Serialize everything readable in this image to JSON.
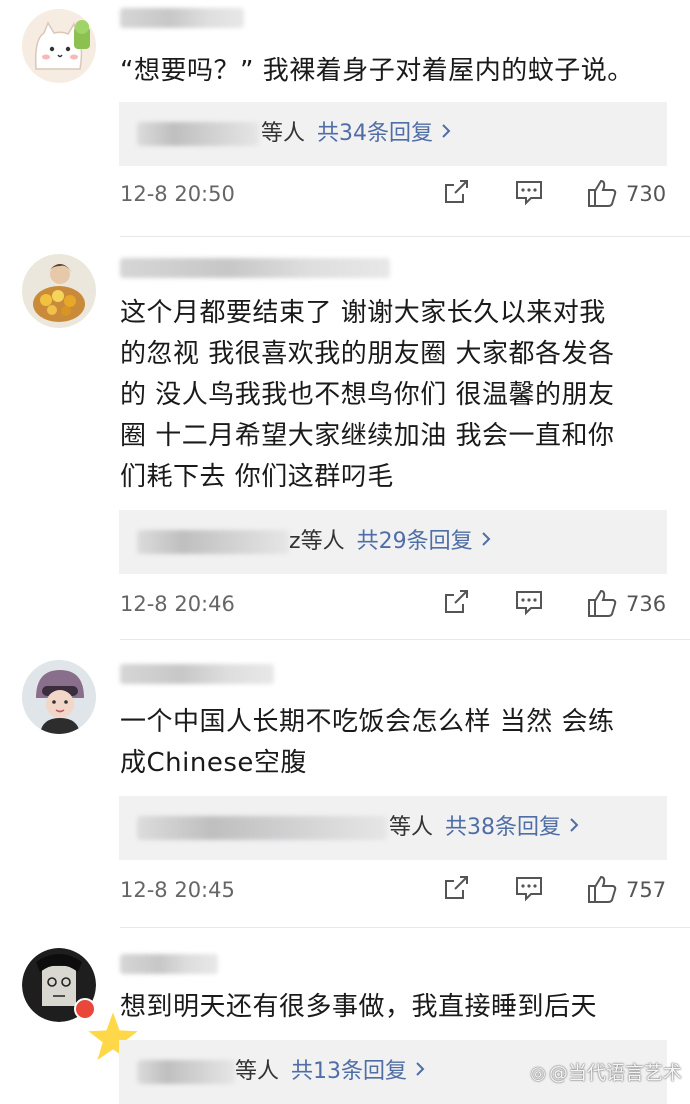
{
  "comments": [
    {
      "text_lines": [
        "“想要吗？” 我裸着身子对着屋内的蚊子说。"
      ],
      "replies": {
        "others": "等人",
        "count": "共34条回复"
      },
      "time": "12-8 20:50",
      "likes": "730"
    },
    {
      "text_lines": [
        "这个月都要结束了 谢谢大家长久以来对我",
        "的忽视 我很喜欢我的朋友圈 大家都各发各",
        "的 没人鸟我我也不想鸟你们 很温馨的朋友",
        "圈 十二月希望大家继续加油 我会一直和你",
        "们耗下去 你们这群叼毛"
      ],
      "replies": {
        "name_suffix": "z",
        "others": "等人",
        "count": "共29条回复"
      },
      "time": "12-8 20:46",
      "likes": "736"
    },
    {
      "text_lines": [
        "一个中国人长期不吃饭会怎么样 当然 会练",
        "成Chinese空腹"
      ],
      "replies": {
        "others": "等人",
        "count": "共38条回复"
      },
      "time": "12-8 20:45",
      "likes": "757"
    },
    {
      "text_lines": [
        "想到明天还有很多事做，我直接睡到后天"
      ],
      "replies": {
        "others": "等人",
        "count": "共13条回复"
      }
    }
  ],
  "watermark": {
    "icon": "weibo-icon",
    "text": "@当代语言艺术"
  },
  "colors": {
    "link": "#4f6ea6",
    "reply_bg": "#f1f1f2",
    "meta": "#666666",
    "badge": "#e8473a"
  }
}
